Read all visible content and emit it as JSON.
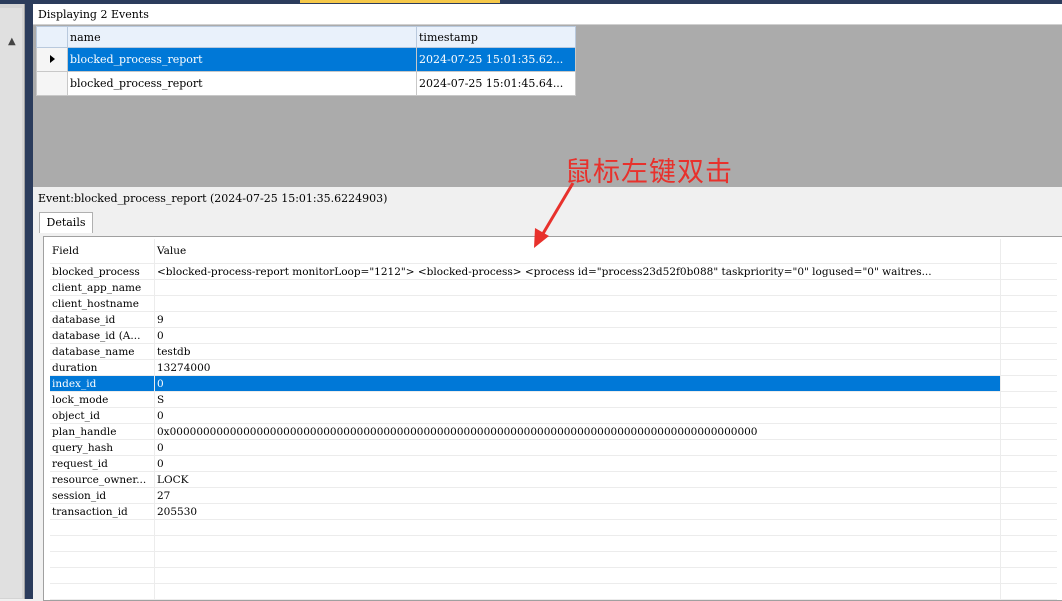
{
  "header": {
    "title": "Displaying 2 Events"
  },
  "events": {
    "columns": [
      "name",
      "timestamp"
    ],
    "rows": [
      {
        "name": "blocked_process_report",
        "timestamp": "2024-07-25 15:01:35.62...",
        "selected": true
      },
      {
        "name": "blocked_process_report",
        "timestamp": "2024-07-25 15:01:45.64...",
        "selected": false
      }
    ]
  },
  "event_title": "Event:blocked_process_report (2024-07-25 15:01:35.6224903)",
  "tabs": {
    "details": "Details"
  },
  "details": {
    "columns": [
      "Field",
      "Value"
    ],
    "rows": [
      {
        "field": "blocked_process",
        "value": "<blocked-process-report monitorLoop=\"1212\">   <blocked-process>    <process id=\"process23d52f0b088\" taskpriority=\"0\" logused=\"0\" waitres..."
      },
      {
        "field": "client_app_name",
        "value": ""
      },
      {
        "field": "client_hostname",
        "value": ""
      },
      {
        "field": "database_id",
        "value": "9"
      },
      {
        "field": "database_id (A...",
        "value": "0"
      },
      {
        "field": "database_name",
        "value": "testdb"
      },
      {
        "field": "duration",
        "value": "13274000"
      },
      {
        "field": "index_id",
        "value": "0",
        "selected": true
      },
      {
        "field": "lock_mode",
        "value": "S"
      },
      {
        "field": "object_id",
        "value": "0"
      },
      {
        "field": "plan_handle",
        "value": "0x0000000000000000000000000000000000000000000000000000000000000000000000000000000000000000"
      },
      {
        "field": "query_hash",
        "value": "0"
      },
      {
        "field": "request_id",
        "value": "0"
      },
      {
        "field": "resource_owner...",
        "value": "LOCK"
      },
      {
        "field": "session_id",
        "value": "27"
      },
      {
        "field": "transaction_id",
        "value": "205530"
      }
    ]
  },
  "annotation": {
    "text": "鼠标左键双击",
    "color": "#e8312c"
  },
  "colors": {
    "selection": "#0078d7",
    "frame": "#2b3c5c"
  }
}
